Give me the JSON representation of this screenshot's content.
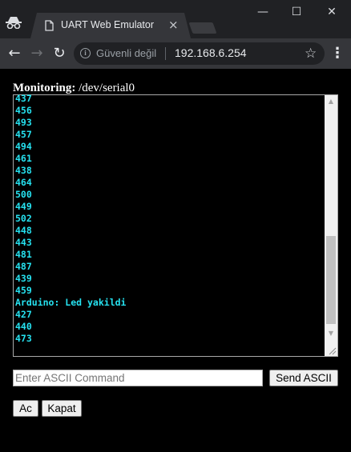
{
  "browser": {
    "tab_title": "UART Web Emulator",
    "tab_close": "×",
    "secure_label": "Güvenli değil",
    "url": "192.168.6.254",
    "window_controls": {
      "minimize": "—",
      "maximize": "☐",
      "close": "✕"
    },
    "nav": {
      "back": "←",
      "forward": "→",
      "reload": "↻",
      "menu": "⋮",
      "star": "☆"
    },
    "icons": [
      "incognito-icon",
      "page-icon",
      "info-icon",
      "star-icon"
    ]
  },
  "page": {
    "heading_label": "Monitoring:",
    "device": "/dev/serial0",
    "log_color": "#26e2f0",
    "log_lines": [
      "437",
      "456",
      "493",
      "457",
      "494",
      "461",
      "438",
      "464",
      "500",
      "449",
      "502",
      "448",
      "443",
      "481",
      "487",
      "439",
      "459",
      "Arduino: Led yakildi",
      "427",
      "440",
      "473"
    ],
    "command": {
      "placeholder": "Enter ASCII Command",
      "value": "",
      "send_label": "Send ASCII"
    },
    "buttons": {
      "on_label": "Ac",
      "off_label": "Kapat"
    }
  }
}
